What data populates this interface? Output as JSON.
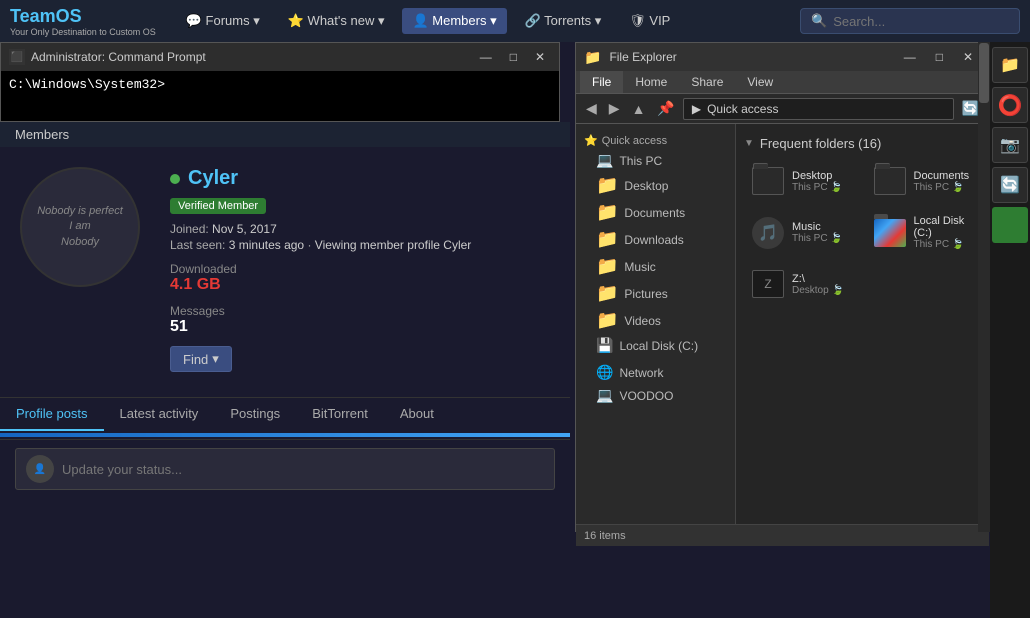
{
  "header": {
    "logo_title": "TeamOS",
    "logo_sub": "Your Only Destination to Custom OS",
    "nav": [
      {
        "label": "Forums",
        "icon": "💬",
        "active": false
      },
      {
        "label": "What's new",
        "icon": "⭐",
        "active": false
      },
      {
        "label": "Members",
        "icon": "👤",
        "active": true
      },
      {
        "label": "Torrents",
        "icon": "🔗",
        "active": false
      },
      {
        "label": "VIP",
        "icon": "🛡",
        "active": false
      }
    ],
    "search_placeholder": "Search..."
  },
  "cmd": {
    "title": "Administrator: Command Prompt",
    "prompt": "C:\\Windows\\System32>"
  },
  "profile": {
    "username": "Cyler",
    "online": true,
    "badge": "Verified Member",
    "joined": "Nov 5, 2017",
    "last_seen": "3 minutes ago",
    "viewing": "Viewing member profile Cyler",
    "downloaded_label": "Downloaded",
    "downloaded_value": "4.1 GB",
    "messages_label": "Messages",
    "messages_value": "51",
    "find_label": "Find",
    "avatar_text": "Nobody is perfect\nI am\nNobody"
  },
  "tabs": [
    {
      "label": "Profile posts",
      "active": true
    },
    {
      "label": "Latest activity",
      "active": false
    },
    {
      "label": "Postings",
      "active": false
    },
    {
      "label": "BitTorrent",
      "active": false
    },
    {
      "label": "About",
      "active": false
    }
  ],
  "post_placeholder": "Update your status...",
  "file_explorer": {
    "title": "File Explorer",
    "ribbon_tabs": [
      "File",
      "Home",
      "Share",
      "View"
    ],
    "active_ribbon_tab": "File",
    "address_path": "Quick access",
    "nav_items": [
      {
        "label": "Quick access",
        "icon": "⭐",
        "section": true
      },
      {
        "label": "This PC",
        "icon": "💻"
      },
      {
        "label": "Desktop",
        "icon": "📁"
      },
      {
        "label": "Documents",
        "icon": "📁"
      },
      {
        "label": "Downloads",
        "icon": "📁"
      },
      {
        "label": "Music",
        "icon": "📁"
      },
      {
        "label": "Pictures",
        "icon": "📁"
      },
      {
        "label": "Videos",
        "icon": "📁"
      },
      {
        "label": "Local Disk (C:)",
        "icon": "💾"
      },
      {
        "label": "Network",
        "icon": "🌐"
      },
      {
        "label": "VOODOO",
        "icon": "💻"
      }
    ],
    "frequent_folders_title": "Frequent folders (16)",
    "frequent_folders": [
      {
        "name": "Desktop",
        "sub": "This PC",
        "leaf": true
      },
      {
        "name": "Documents",
        "sub": "This PC",
        "leaf": true
      },
      {
        "name": "Music",
        "sub": "This PC",
        "leaf": true
      },
      {
        "name": "Local Disk (C:)",
        "sub": "This PC",
        "leaf": true
      },
      {
        "name": "Z:\\",
        "sub": "Desktop",
        "leaf": true
      }
    ],
    "status_bar": "16 items"
  }
}
